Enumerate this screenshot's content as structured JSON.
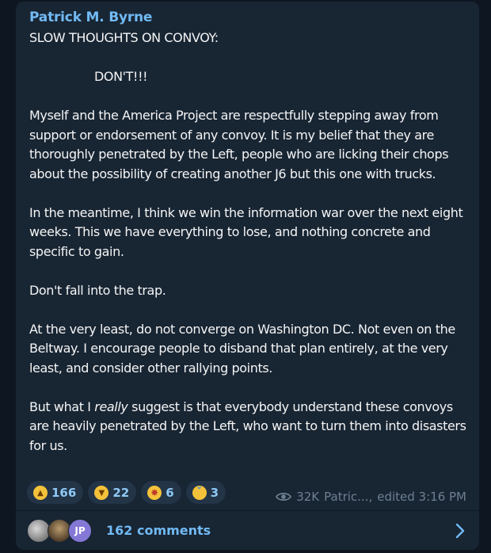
{
  "post": {
    "author": "Patrick M. Byrne",
    "title": "SLOW THOUGHTS ON CONVOY:",
    "dont": "DON'T!!!",
    "p1": "Myself and the America Project are respectfully stepping away from support or endorsement of any convoy. It is my belief that they are thoroughly penetrated by the Left, people who are licking their chops about the possibility of creating another J6 but this one with trucks.",
    "p2": " In the meantime, I think we win the information war over the next eight weeks. This we have everything to lose, and nothing concrete and specific to gain.",
    "p3": "Don't fall into the trap.",
    "p4": "At the very least, do not converge on Washington DC. Not even on the Beltway. I encourage people to  disband that plan entirely, at the very least, and consider other rallying points.",
    "p5_pre": "But what I ",
    "p5_em": "really",
    "p5_post": " suggest is that everybody understand these convoys are heavily penetrated by the Left, who want to turn them into disasters for us."
  },
  "reactions": [
    {
      "icon": "thumbs-up-icon",
      "count": "166"
    },
    {
      "icon": "thumbs-down-icon",
      "count": "22"
    },
    {
      "icon": "exploding-head-icon",
      "count": "6"
    },
    {
      "icon": "crying-face-icon",
      "count": "3"
    }
  ],
  "meta": {
    "views": "32K",
    "author_short": "Patric...,",
    "edited": "edited 3:16 PM"
  },
  "comments": {
    "avatar_initials": "JP",
    "label": "162 comments"
  },
  "colors": {
    "background": "#0e1621",
    "bubble": "#182533",
    "accent": "#71baf4",
    "text": "#f5f5f5",
    "meta": "#6d8093"
  }
}
